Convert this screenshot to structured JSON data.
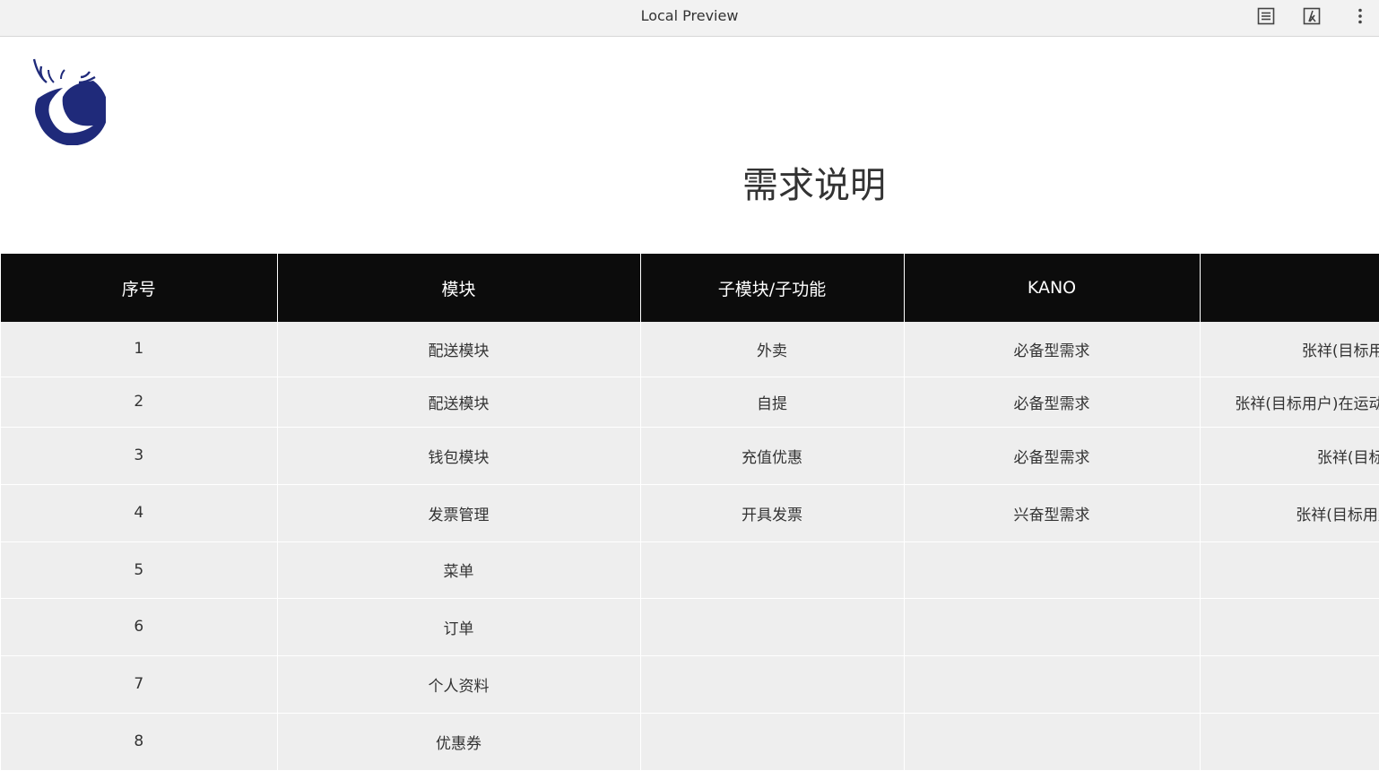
{
  "window": {
    "title": "Local Preview"
  },
  "toolbar": {
    "icons": [
      "document-icon",
      "formula-icon",
      "more-vertical-icon"
    ]
  },
  "page": {
    "title": "需求说明"
  },
  "table": {
    "headers": [
      "序号",
      "模块",
      "子模块/子功能",
      "KANO",
      ""
    ],
    "rows": [
      {
        "no": "1",
        "module": "配送模块",
        "sub": "外卖",
        "kano": "必备型需求",
        "desc": "张祥(目标用户"
      },
      {
        "no": "2",
        "module": "配送模块",
        "sub": "自提",
        "kano": "必备型需求",
        "desc": "张祥(目标用户)在运动场"
      },
      {
        "no": "3",
        "module": "钱包模块",
        "sub": "充值优惠",
        "kano": "必备型需求",
        "desc": "张祥(目标用"
      },
      {
        "no": "4",
        "module": "发票管理",
        "sub": "开具发票",
        "kano": "兴奋型需求",
        "desc": "张祥(目标用户)"
      },
      {
        "no": "5",
        "module": "菜单",
        "sub": "",
        "kano": "",
        "desc": ""
      },
      {
        "no": "6",
        "module": "订单",
        "sub": "",
        "kano": "",
        "desc": ""
      },
      {
        "no": "7",
        "module": "个人资料",
        "sub": "",
        "kano": "",
        "desc": ""
      },
      {
        "no": "8",
        "module": "优惠券",
        "sub": "",
        "kano": "",
        "desc": ""
      }
    ]
  },
  "colors": {
    "header_bg": "#0c0c0c",
    "row_bg": "#eeeeee",
    "logo": "#1f2a7a"
  }
}
